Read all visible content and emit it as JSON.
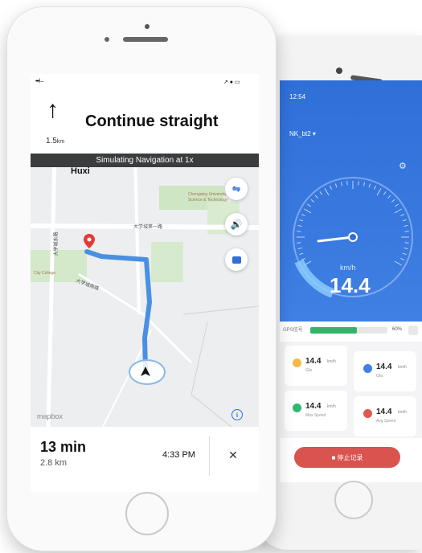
{
  "front": {
    "status": {
      "signal": "•••l ⌢",
      "right": "↗ ● ▭"
    },
    "nav": {
      "arrow": "↑",
      "distance": "1.5",
      "distance_unit": "km",
      "instruction": "Continue straight"
    },
    "banner": "Simulating Navigation at 1x",
    "map": {
      "place_huxi": "Huxi",
      "place_university": "Chongqing University",
      "place_university_sub": "Science & Technology",
      "road_main": "大学城第一路",
      "road_side": "大学城南路",
      "place_left": "City College",
      "road_vertical": "大学城东路",
      "watermark": "mapbox"
    },
    "trip": {
      "time": "13 min",
      "distance": "2.8 km",
      "eta": "4:33 PM",
      "close": "✕"
    },
    "icons": {
      "route": "route-icon",
      "sound": "speaker-icon",
      "feedback": "chat-icon",
      "info": "info-icon",
      "puck": "navigation-arrow-icon"
    }
  },
  "back": {
    "status": "12:54",
    "title": "NK_bt2 ▾",
    "speed": "14.4",
    "unit": "km/h",
    "gps_label": "GPS信号",
    "gps_value": "60%",
    "stats": [
      {
        "value": "14.4",
        "unit": "km/h",
        "label": "Gfa",
        "color": "#f5b94a"
      },
      {
        "value": "14.4",
        "unit": "km/h",
        "label": "Gfa",
        "color": "#3f80e4"
      },
      {
        "value": "14.4",
        "unit": "km/h",
        "label": "Max Speed",
        "color": "#2eb872"
      },
      {
        "value": "14.4",
        "unit": "km/h",
        "label": "Avg Speed",
        "color": "#e0574f"
      }
    ],
    "stop_button": "■ 停止记录",
    "gps_level": 0.6
  }
}
